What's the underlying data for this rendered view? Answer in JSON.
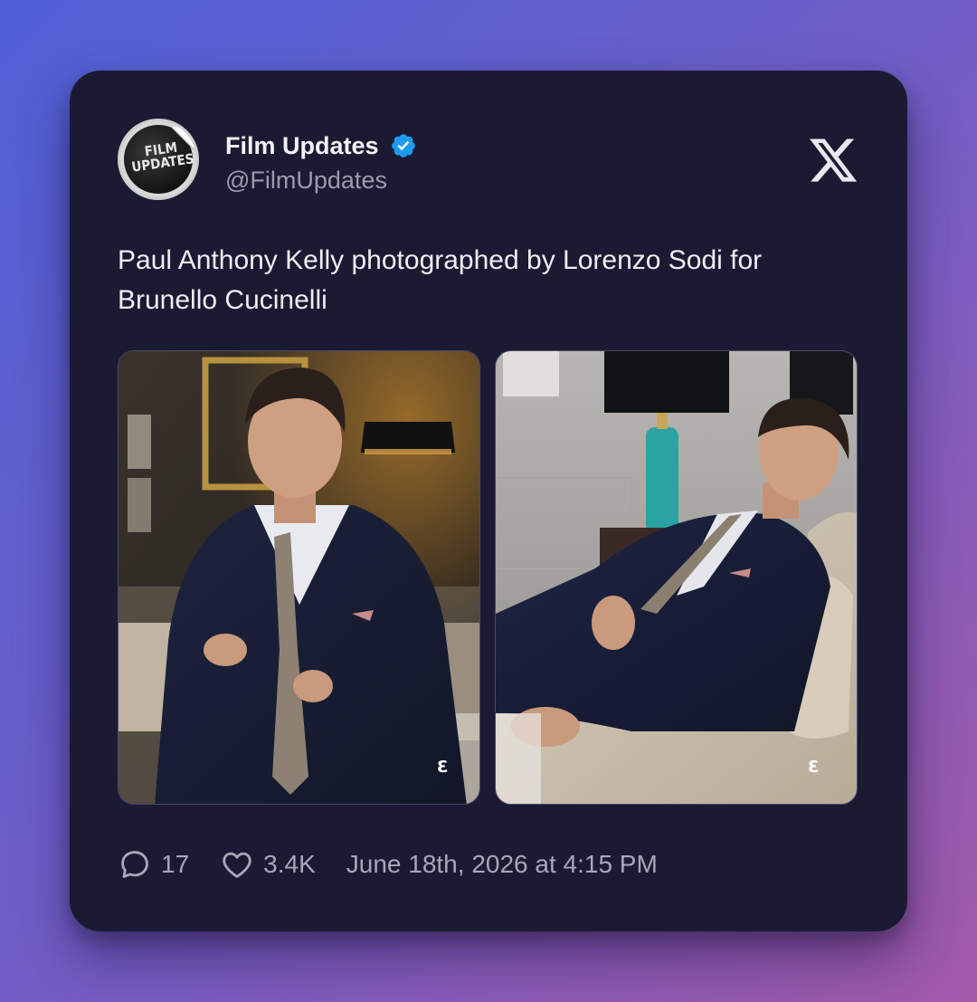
{
  "account": {
    "name": "Film Updates",
    "handle": "@FilmUpdates",
    "avatar_text_line1": "FILM",
    "avatar_text_line2": "UPDATES",
    "verified": true,
    "verified_color": "#1d9bf0"
  },
  "brand_icon": "x-logo-icon",
  "tweet": {
    "text_line1": "Paul Anthony Kelly photographed by Lorenzo Sodi for",
    "text_line2": "Brunello Cucinelli"
  },
  "photos": [
    {
      "name": "photo-seated-tie"
    },
    {
      "name": "photo-reclining-sofa"
    }
  ],
  "stats": {
    "replies": "17",
    "likes": "3.4K",
    "timestamp": "June 18th, 2026 at 4:15 PM"
  },
  "colors": {
    "card_bg": "#1b1a33",
    "text_primary": "#f2f2f6",
    "text_secondary": "#9b9bae"
  }
}
